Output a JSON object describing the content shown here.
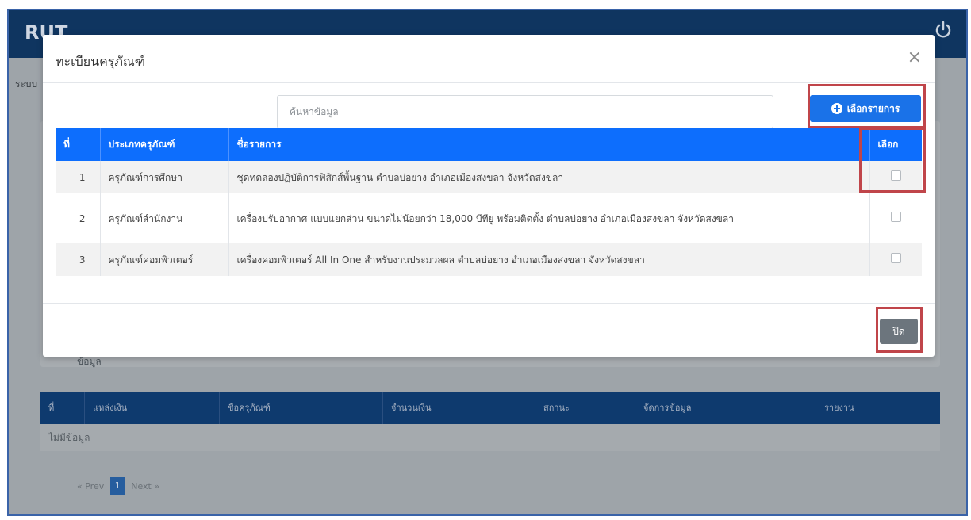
{
  "background": {
    "logo": "RUT",
    "breadcrumb": "ระบบ",
    "card_label": "ข้อมูล",
    "table_headers": [
      "ที่",
      "แหล่งเงิน",
      "ชื่อครุภัณฑ์",
      "จำนวนเงิน",
      "สถานะ",
      "จัดการข้อมูล",
      "รายงาน"
    ],
    "empty_text": "ไม่มีข้อมูล",
    "pager": {
      "prev": "« Prev",
      "page": "1",
      "next": "Next »"
    }
  },
  "modal": {
    "title": "ทะเบียนครุภัณฑ์",
    "close_icon": "×",
    "search": {
      "placeholder": "ค้นหาข้อมูล"
    },
    "select_button_label": "เลือกรายการ",
    "table": {
      "headers": {
        "no": "ที่",
        "category": "ประเภทครุภัณฑ์",
        "name": "ชื่อรายการ",
        "select": "เลือก"
      },
      "rows": [
        {
          "no": "1",
          "category": "ครุภัณฑ์การศึกษา",
          "name": "ชุดทดลองปฏิบัติการฟิสิกส์พื้นฐาน ตำบลบ่อยาง อำเภอเมืองสงขลา จังหวัดสงขลา"
        },
        {
          "no": "2",
          "category": "ครุภัณฑ์สำนักงาน",
          "name": "เครื่องปรับอากาศ แบบแยกส่วน ขนาดไม่น้อยกว่า 18,000 บีทียู พร้อมติดตั้ง ตำบลบ่อยาง อำเภอเมืองสงขลา จังหวัดสงขลา"
        },
        {
          "no": "3",
          "category": "ครุภัณฑ์คอมพิวเตอร์",
          "name": "เครื่องคอมพิวเตอร์ All In One สำหรับงานประมวลผล ตำบลบ่อยาง อำเภอเมืองสงขลา จังหวัดสงขลา"
        }
      ]
    },
    "close_button_label": "ปิด"
  },
  "colors": {
    "primary": "#0d6efd",
    "highlight": "#c0454a",
    "secondary": "#6c757d"
  }
}
